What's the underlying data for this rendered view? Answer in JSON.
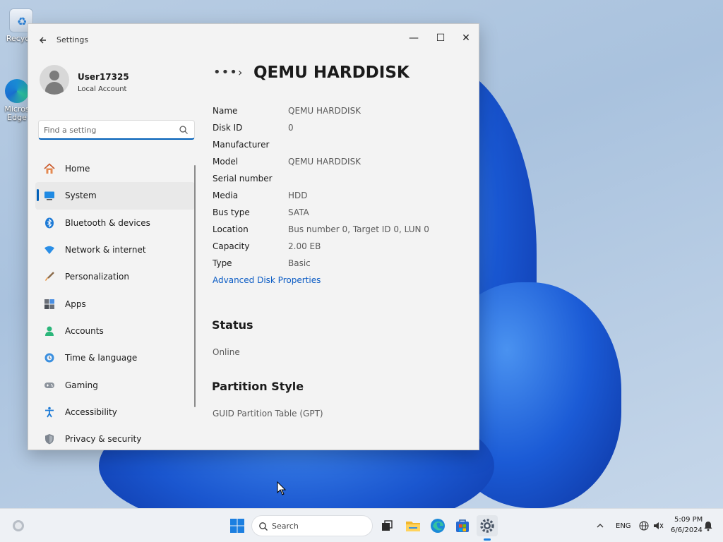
{
  "desktop": {
    "icons": [
      {
        "name": "recycle-bin",
        "label": "Recycle"
      },
      {
        "name": "microsoft-edge",
        "label": "Micros Edge"
      }
    ]
  },
  "window": {
    "app_title": "Settings",
    "back_icon": "arrow-left-icon",
    "controls": {
      "minimize": "—",
      "maximize": "☐",
      "close": "✕"
    }
  },
  "user": {
    "name": "User17325",
    "account_type": "Local Account"
  },
  "search": {
    "placeholder": "Find a setting"
  },
  "nav": {
    "items": [
      {
        "label": "Home",
        "icon": "home-icon"
      },
      {
        "label": "System",
        "icon": "system-icon",
        "active": true
      },
      {
        "label": "Bluetooth & devices",
        "icon": "bluetooth-icon"
      },
      {
        "label": "Network & internet",
        "icon": "wifi-icon"
      },
      {
        "label": "Personalization",
        "icon": "brush-icon"
      },
      {
        "label": "Apps",
        "icon": "apps-icon"
      },
      {
        "label": "Accounts",
        "icon": "accounts-icon"
      },
      {
        "label": "Time & language",
        "icon": "globe-clock-icon"
      },
      {
        "label": "Gaming",
        "icon": "gamepad-icon"
      },
      {
        "label": "Accessibility",
        "icon": "accessibility-icon"
      },
      {
        "label": "Privacy & security",
        "icon": "shield-icon"
      }
    ]
  },
  "content": {
    "breadcrumb_more": "•••",
    "breadcrumb_sep": "›",
    "title": "QEMU HARDDISK",
    "properties": [
      {
        "key": "Name",
        "value": "QEMU HARDDISK"
      },
      {
        "key": "Disk ID",
        "value": "0"
      },
      {
        "key": "Manufacturer",
        "value": ""
      },
      {
        "key": "Model",
        "value": "QEMU HARDDISK"
      },
      {
        "key": "Serial number",
        "value": ""
      },
      {
        "key": "Media",
        "value": "HDD"
      },
      {
        "key": "Bus type",
        "value": "SATA"
      },
      {
        "key": "Location",
        "value": "Bus number 0, Target ID 0, LUN 0"
      },
      {
        "key": "Capacity",
        "value": "2.00 EB"
      },
      {
        "key": "Type",
        "value": "Basic"
      }
    ],
    "advanced_link": "Advanced Disk Properties",
    "status": {
      "heading": "Status",
      "value": "Online"
    },
    "partition": {
      "heading": "Partition Style",
      "value": "GUID Partition Table (GPT)"
    }
  },
  "taskbar": {
    "search_label": "Search",
    "tray": {
      "language": "ENG",
      "time": "5:09 PM",
      "date": "6/6/2024"
    }
  }
}
